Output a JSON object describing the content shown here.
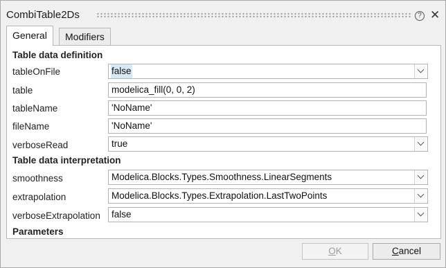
{
  "window": {
    "title": "CombiTable2Ds"
  },
  "tabs": [
    {
      "label": "General"
    },
    {
      "label": "Modifiers"
    }
  ],
  "sections": {
    "definition": "Table data definition",
    "interpretation": "Table data interpretation",
    "parameters": "Parameters"
  },
  "params": {
    "tableOnFile": {
      "label": "tableOnFile",
      "value": "false"
    },
    "table": {
      "label": "table",
      "value": "modelica_fill(0, 0, 2)"
    },
    "tableName": {
      "label": "tableName",
      "value": "'NoName'"
    },
    "fileName": {
      "label": "fileName",
      "value": "'NoName'"
    },
    "verboseRead": {
      "label": "verboseRead",
      "value": "true"
    },
    "smoothness": {
      "label": "smoothness",
      "value": "Modelica.Blocks.Types.Smoothness.LinearSegments"
    },
    "extrapolation": {
      "label": "extrapolation",
      "value": "Modelica.Blocks.Types.Extrapolation.LastTwoPoints"
    },
    "verboseExtrapolation": {
      "label": "verboseExtrapolation",
      "value": "false"
    }
  },
  "buttons": {
    "ok": {
      "mnemonic": "O",
      "rest": "K"
    },
    "cancel": {
      "mnemonic": "C",
      "rest": "ancel"
    }
  },
  "icons": {
    "help": "help-icon",
    "close": "close-icon"
  }
}
